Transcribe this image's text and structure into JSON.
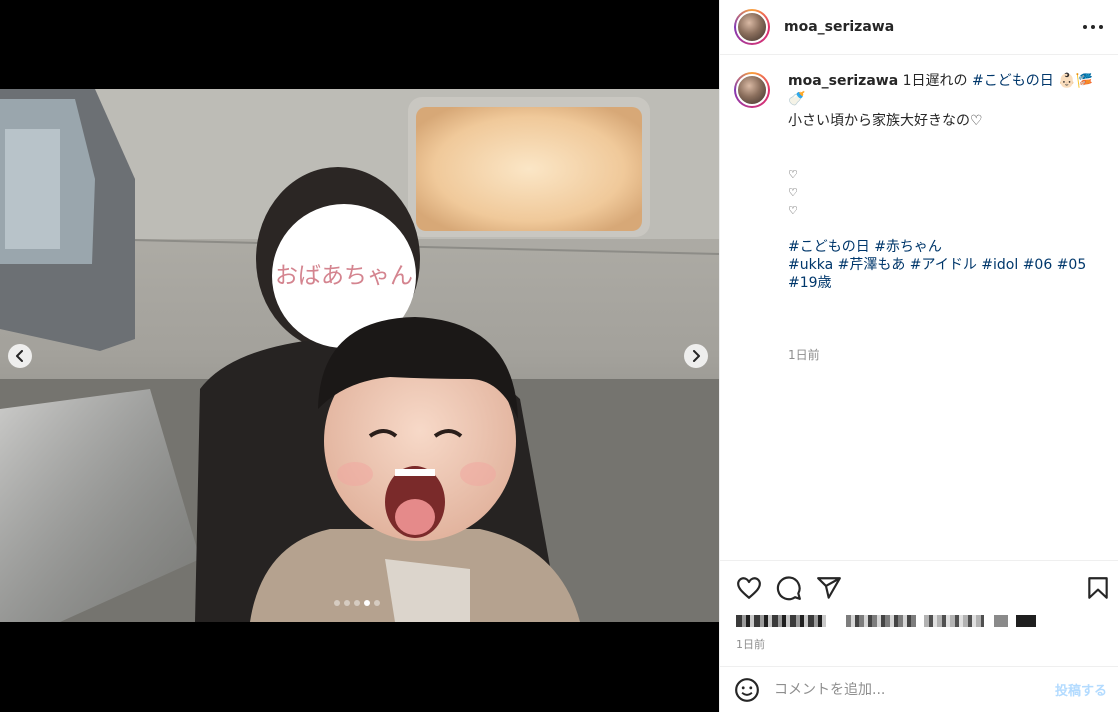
{
  "post": {
    "username": "moa_serizawa",
    "photo_overlay_text": "おばあちゃん",
    "carousel": {
      "total": 5,
      "active_index": 3
    }
  },
  "caption": {
    "username": "moa_serizawa",
    "intro_text": "1日遅れの",
    "intro_tag": "#こどもの日",
    "intro_emoji": "👶🏻🎏🍼",
    "line2": "小さい頃から家族大好きなの♡",
    "hearts": [
      "♡",
      "♡",
      "♡"
    ],
    "tags_line1": [
      "#こどもの日",
      "#赤ちゃん"
    ],
    "tags_line2": [
      "#ukka",
      "#芹澤もあ",
      "#アイドル",
      "#idol",
      "#06",
      "#05",
      "#19歳"
    ],
    "time": "1日前"
  },
  "footer": {
    "date": "1日前",
    "comment_placeholder": "コメントを追加...",
    "post_label": "投稿する"
  },
  "colors": {
    "hashtag": "#00376b",
    "post_button": "#b3dbff",
    "text": "#262626",
    "muted": "#8e8e8e"
  },
  "icons": [
    "chevron-left-icon",
    "chevron-right-icon",
    "more-icon",
    "heart-icon",
    "comment-icon",
    "share-icon",
    "bookmark-icon",
    "emoji-icon"
  ]
}
